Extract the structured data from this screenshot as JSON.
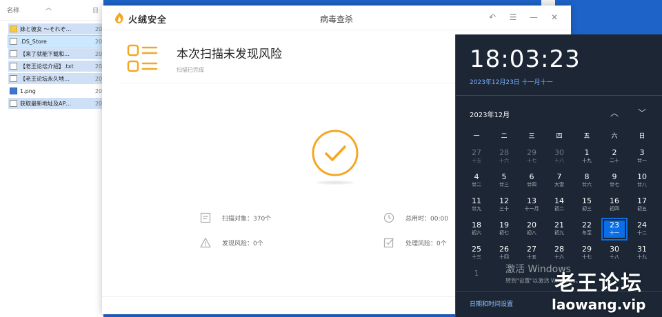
{
  "explorer": {
    "column_name": "名称",
    "column_date": "日",
    "files": [
      {
        "name": "妹と彼女 ～それぞ…",
        "date": "20",
        "type": "folder",
        "state": "selected"
      },
      {
        "name": ".DS_Store",
        "date": "20",
        "type": "file",
        "state": "focus"
      },
      {
        "name": "【来了就能下载和…",
        "date": "20",
        "type": "file",
        "state": "selected"
      },
      {
        "name": "【老王论坛介绍】.txt",
        "date": "20",
        "type": "file",
        "state": "selected"
      },
      {
        "name": "【老王论坛永久地…",
        "date": "20",
        "type": "file",
        "state": "selected"
      },
      {
        "name": "1.png",
        "date": "20",
        "type": "image",
        "state": "none"
      },
      {
        "name": "获取最新地址及AP…",
        "date": "20",
        "type": "file",
        "state": "selected"
      }
    ]
  },
  "huorong": {
    "app_name": "火绒安全",
    "page_title": "病毒查杀",
    "result_title": "本次扫描未发现风险",
    "result_sub": "扫描已完成",
    "stats": {
      "scan_objects": "扫描对象：370个",
      "total_time": "总用时：00:00",
      "risks_found": "发现风险：0个",
      "risks_handled": "处理风险：0个"
    },
    "colors": {
      "accent": "#f5a623"
    }
  },
  "flyout": {
    "time": "18:03:23",
    "date": "2023年12月23日 十一月十一",
    "month": "2023年12月",
    "weekdays": [
      "一",
      "二",
      "三",
      "四",
      "五",
      "六",
      "日"
    ],
    "days": [
      {
        "n": "27",
        "l": "十五",
        "other": true
      },
      {
        "n": "28",
        "l": "十六",
        "other": true
      },
      {
        "n": "29",
        "l": "十七",
        "other": true
      },
      {
        "n": "30",
        "l": "十八",
        "other": true
      },
      {
        "n": "1",
        "l": "十九"
      },
      {
        "n": "2",
        "l": "二十"
      },
      {
        "n": "3",
        "l": "廿一"
      },
      {
        "n": "4",
        "l": "廿二"
      },
      {
        "n": "5",
        "l": "廿三"
      },
      {
        "n": "6",
        "l": "廿四"
      },
      {
        "n": "7",
        "l": "大雪"
      },
      {
        "n": "8",
        "l": "廿六"
      },
      {
        "n": "9",
        "l": "廿七"
      },
      {
        "n": "10",
        "l": "廿八"
      },
      {
        "n": "11",
        "l": "廿九"
      },
      {
        "n": "12",
        "l": "三十"
      },
      {
        "n": "13",
        "l": "十一月"
      },
      {
        "n": "14",
        "l": "初二"
      },
      {
        "n": "15",
        "l": "初三"
      },
      {
        "n": "16",
        "l": "初四"
      },
      {
        "n": "17",
        "l": "初五"
      },
      {
        "n": "18",
        "l": "初六"
      },
      {
        "n": "19",
        "l": "初七"
      },
      {
        "n": "20",
        "l": "初八"
      },
      {
        "n": "21",
        "l": "初九"
      },
      {
        "n": "22",
        "l": "冬至"
      },
      {
        "n": "23",
        "l": "十一",
        "today": true
      },
      {
        "n": "24",
        "l": "十二"
      },
      {
        "n": "25",
        "l": "十三"
      },
      {
        "n": "26",
        "l": "十四"
      },
      {
        "n": "27",
        "l": "十五"
      },
      {
        "n": "28",
        "l": "十六"
      },
      {
        "n": "29",
        "l": "十七"
      },
      {
        "n": "30",
        "l": "十八"
      },
      {
        "n": "31",
        "l": "十九"
      },
      {
        "n": "1",
        "l": "",
        "other": true
      }
    ],
    "settings_link": "日期和时间设置",
    "nav_up": "︿",
    "nav_down": "﹀"
  },
  "activation": {
    "line1": "激活 Windows",
    "line2": "转到\"设置\"以激活 Windows。"
  },
  "watermark": {
    "line1": "老王论坛",
    "line2": "laowang.vip"
  }
}
